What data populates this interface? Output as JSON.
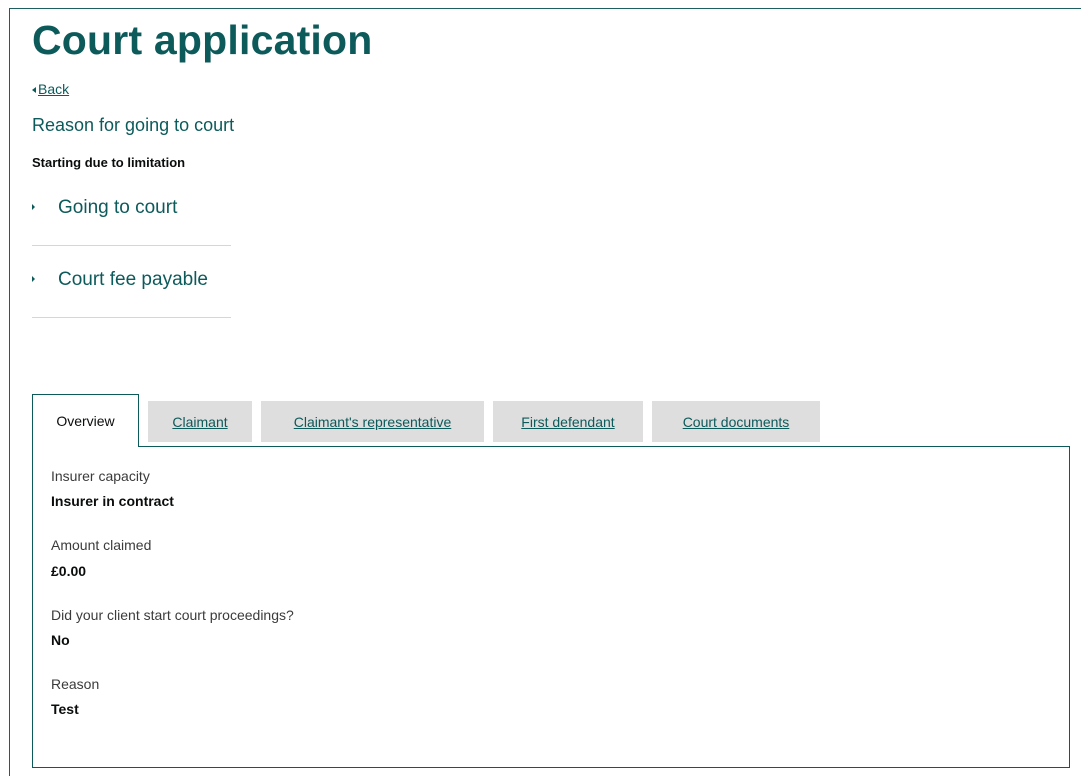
{
  "page": {
    "title": "Court application",
    "back_label": "Back"
  },
  "reason": {
    "heading": "Reason for going to court",
    "value": "Starting due to limitation"
  },
  "accordion": {
    "items": [
      {
        "label": "Going to court"
      },
      {
        "label": "Court fee payable"
      }
    ]
  },
  "tabs": [
    {
      "label": "Overview",
      "active": true
    },
    {
      "label": "Claimant",
      "active": false
    },
    {
      "label": "Claimant's representative",
      "active": false
    },
    {
      "label": "First defendant",
      "active": false
    },
    {
      "label": "Court documents",
      "active": false
    }
  ],
  "overview": {
    "fields": [
      {
        "label": "Insurer capacity",
        "value": "Insurer in contract"
      },
      {
        "label": "Amount claimed",
        "value": "£0.00"
      },
      {
        "label": "Did your client start court proceedings?",
        "value": "No"
      },
      {
        "label": "Reason",
        "value": "Test"
      }
    ]
  },
  "colors": {
    "brand_teal": "#0d5a5b",
    "tab_inactive_bg": "#dedede",
    "divider": "#d6d6d6"
  }
}
